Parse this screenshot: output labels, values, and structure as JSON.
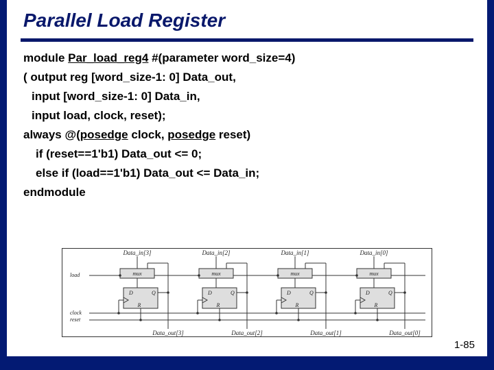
{
  "title": "Parallel Load Register",
  "code": {
    "l1a": "module ",
    "l1b": "Par_load_reg4",
    "l1c": " #(parameter  word_size=4)",
    "l2": "( output reg [word_size-1: 0] Data_out,",
    "l3": "input [word_size-1: 0] Data_in,",
    "l4": "input load, clock, reset);",
    "l5a": "always @(",
    "l5b": "posedge",
    "l5c": " clock, ",
    "l5d": "posedge",
    "l5e": " reset)",
    "l6": "if (reset==1'b1)  Data_out <= 0;",
    "l7": "else if (load==1'b1) Data_out <= Data_in;",
    "l8": "endmodule"
  },
  "diagram": {
    "top_labels": [
      "Data_in[3]",
      "Data_in[2]",
      "Data_in[1]",
      "Data_in[0]"
    ],
    "bot_labels": [
      "Data_out[3]",
      "Data_out[2]",
      "Data_out[1]",
      "Data_out[0]"
    ],
    "left_labels": {
      "load": "load",
      "clock": "clock",
      "reset": "reset"
    },
    "mux": "mux",
    "ff": {
      "d": "D",
      "q": "Q",
      "r": "R"
    }
  },
  "pagenum": "1-85"
}
